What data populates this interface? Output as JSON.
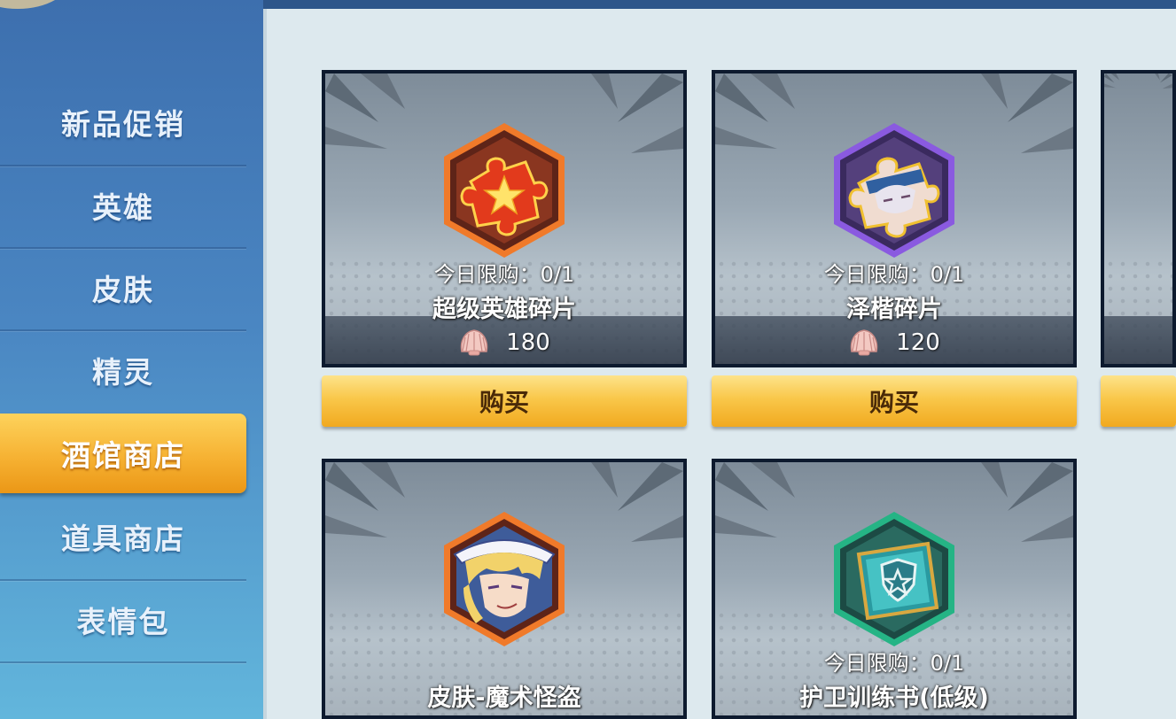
{
  "sidebar": {
    "items": [
      {
        "label": "新品促销"
      },
      {
        "label": "英雄"
      },
      {
        "label": "皮肤"
      },
      {
        "label": "精灵"
      },
      {
        "label": "酒馆商店",
        "active": true
      },
      {
        "label": "道具商店"
      },
      {
        "label": "表情包"
      }
    ]
  },
  "shop": {
    "items": [
      {
        "name": "超级英雄碎片",
        "limit": "今日限购：0/1",
        "price": "180",
        "currency_icon": "shell-icon",
        "buy_label": "购买",
        "icon": "super-hero-fragment-icon",
        "frame_color": "#f07a2a"
      },
      {
        "name": "泽楷碎片",
        "limit": "今日限购：0/1",
        "price": "120",
        "currency_icon": "shell-icon",
        "buy_label": "购买",
        "icon": "zekai-fragment-icon",
        "frame_color": "#8a5ae0"
      },
      {
        "name": "",
        "limit": "",
        "price": "",
        "buy_label": "",
        "icon": "partial-card"
      },
      {
        "name": "皮肤-魔术怪盗",
        "limit": "",
        "icon": "magic-thief-skin-icon",
        "frame_color": "#f07a2a"
      },
      {
        "name": "护卫训练书(低级)",
        "limit": "今日限购：0/1",
        "icon": "guard-training-book-icon",
        "frame_color": "#25b485"
      }
    ]
  },
  "colors": {
    "accent": "#f6b233",
    "panel_bg": "#dde9ee",
    "sidebar_top": "#3d6fae",
    "sidebar_bottom": "#62b6dc"
  }
}
